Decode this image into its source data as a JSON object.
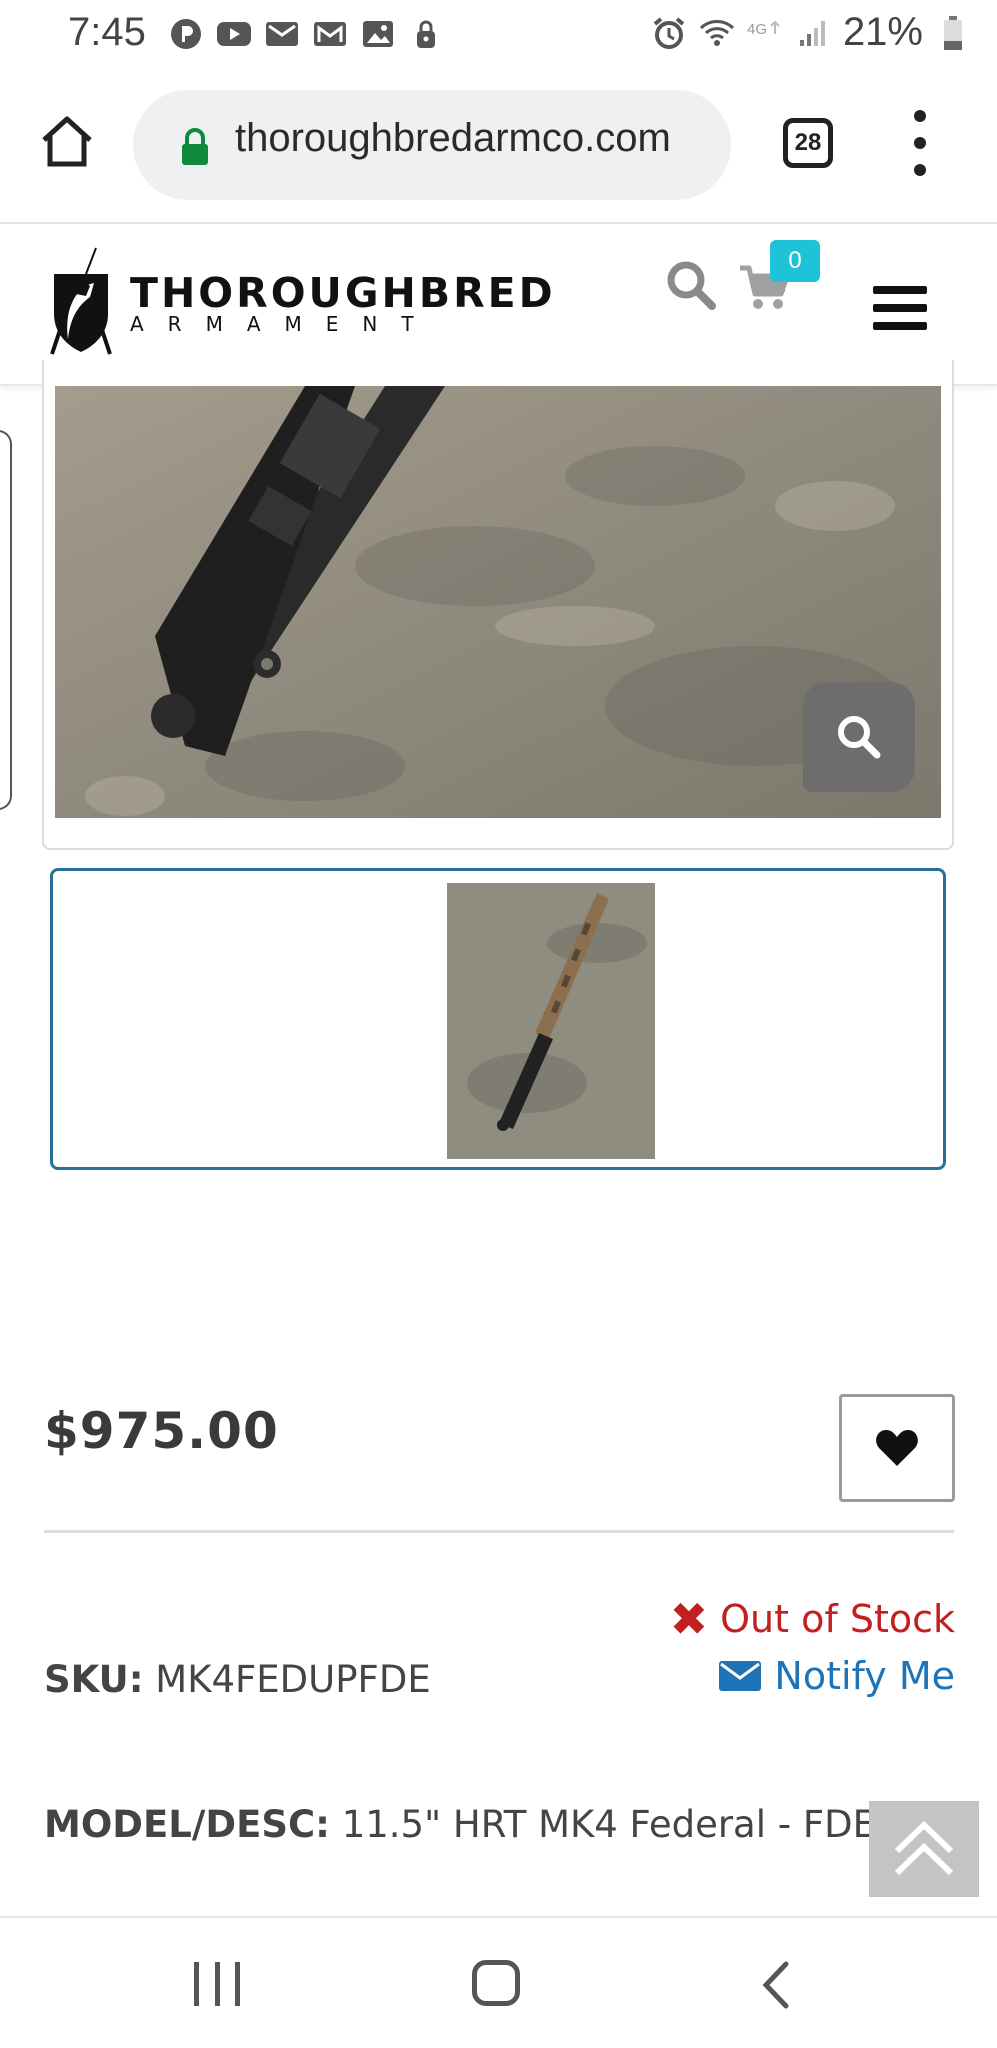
{
  "status_bar": {
    "time": "7:45",
    "battery_percent": "21%",
    "left_icons": [
      "pandora-icon",
      "youtube-icon",
      "mail-icon",
      "gmail-icon",
      "gallery-icon",
      "lock-notification-icon"
    ],
    "right_icons": [
      "alarm-icon",
      "wifi-icon",
      "lte-icon",
      "signal-icon",
      "battery-icon"
    ]
  },
  "browser": {
    "url": "thoroughbredarmco.com",
    "tab_count": "28"
  },
  "site_header": {
    "logo_title": "THOROUGHBRED",
    "logo_subtitle": "ARMAMENT",
    "cart_count": "0"
  },
  "product": {
    "thumbnail_count": 1,
    "price": "$975.00",
    "stock_status": "Out of Stock",
    "notify_label": "Notify Me",
    "sku_label": "SKU:",
    "sku_value": "MK4FEDUPFDE",
    "model_label": "MODEL/DESC:",
    "model_value": "11.5\" HRT MK4 Federal - FDE"
  },
  "colors": {
    "accent_blue": "#1f73b7",
    "thumb_border": "#2a6e9a",
    "out_of_stock_red": "#c21f1f",
    "cart_badge": "#1ec3d7",
    "zoom_button": "#6d6d6d"
  }
}
